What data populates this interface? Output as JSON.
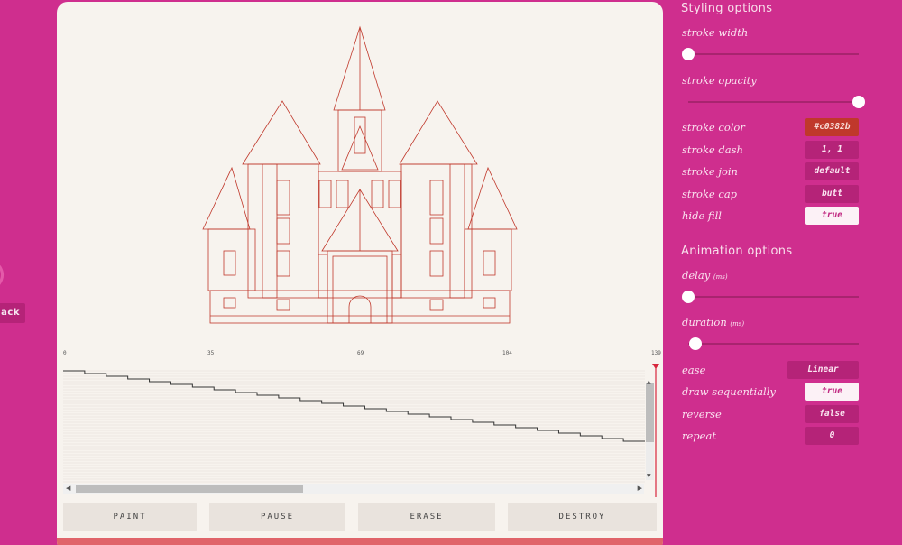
{
  "left_edge": {
    "back_label": "ack"
  },
  "timeline": {
    "ticks": [
      "0",
      "35",
      "69",
      "104",
      "139"
    ]
  },
  "controls": {
    "paint": "PAINT",
    "pause": "PAUSE",
    "erase": "ERASE",
    "destroy": "DESTROY"
  },
  "styling": {
    "title": "Styling options",
    "stroke_width": {
      "label": "stroke width",
      "value_fraction": 0.0
    },
    "stroke_opacity": {
      "label": "stroke opacity",
      "value_fraction": 1.0
    },
    "stroke_color": {
      "label": "stroke color",
      "value": "#c0382b"
    },
    "stroke_dash": {
      "label": "stroke dash",
      "value": "1, 1"
    },
    "stroke_join": {
      "label": "stroke join",
      "value": "default"
    },
    "stroke_cap": {
      "label": "stroke cap",
      "value": "butt"
    },
    "hide_fill": {
      "label": "hide fill",
      "value": "true"
    }
  },
  "animation": {
    "title": "Animation options",
    "delay": {
      "label": "delay",
      "unit": "(ms)",
      "value_fraction": 0.0
    },
    "duration": {
      "label": "duration",
      "unit": "(ms)",
      "value_fraction": 0.04
    },
    "ease": {
      "label": "ease",
      "value": "Linear"
    },
    "draw_sequentially": {
      "label": "draw sequentially",
      "value": "true"
    },
    "reverse": {
      "label": "reverse",
      "value": "false"
    },
    "repeat": {
      "label": "repeat",
      "value": "0"
    }
  },
  "colors": {
    "background": "#cf2e8e",
    "panel": "#f7f3ee",
    "stroke": "#c0382b",
    "accent_bar": "#e0646a"
  }
}
